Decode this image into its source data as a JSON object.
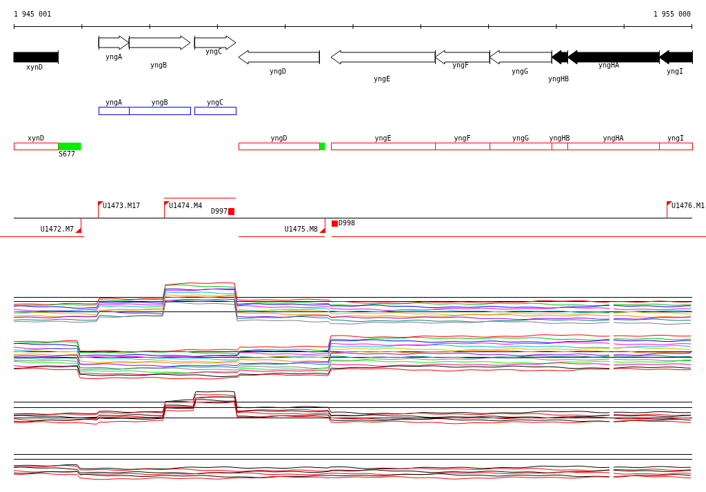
{
  "ruler": {
    "start_label": "1 945 001",
    "end_label": "1 955 000"
  },
  "genes": [
    {
      "name": "xynD",
      "reverse": true,
      "filled": true,
      "arrowhead": false
    },
    {
      "name": "yngA",
      "reverse": false,
      "filled": false,
      "arrowhead": true
    },
    {
      "name": "yngB",
      "reverse": false,
      "filled": false,
      "arrowhead": true
    },
    {
      "name": "yngC",
      "reverse": false,
      "filled": false,
      "arrowhead": true
    },
    {
      "name": "yngD",
      "reverse": true,
      "filled": false,
      "arrowhead": true
    },
    {
      "name": "yngE",
      "reverse": true,
      "filled": false,
      "arrowhead": true
    },
    {
      "name": "yngF",
      "reverse": true,
      "filled": false,
      "arrowhead": true
    },
    {
      "name": "yngG",
      "reverse": true,
      "filled": false,
      "arrowhead": true
    },
    {
      "name": "yngHB",
      "reverse": true,
      "filled": true,
      "arrowhead": true
    },
    {
      "name": "yngHA",
      "reverse": true,
      "filled": true,
      "arrowhead": true
    },
    {
      "name": "yngI",
      "reverse": true,
      "filled": true,
      "arrowhead": true
    }
  ],
  "blue_track": [
    {
      "name": "yngA"
    },
    {
      "name": "yngB"
    },
    {
      "name": "yngC"
    }
  ],
  "red_track": [
    {
      "name": "xynD",
      "green_tail": true,
      "tail_label": "S677"
    },
    {
      "name": "yngD",
      "green_tail": true
    },
    {
      "name": "yngE",
      "green_tail": false
    },
    {
      "name": "yngF",
      "green_tail": false
    },
    {
      "name": "yngG",
      "green_tail": false
    },
    {
      "name": "yngHB",
      "green_tail": false
    },
    {
      "name": "yngHA",
      "green_tail": false
    },
    {
      "name": "yngI",
      "green_tail": false
    }
  ],
  "markers": [
    {
      "label": "U1473.M17",
      "kind": "up"
    },
    {
      "label": "U1474.M4",
      "kind": "up"
    },
    {
      "label": "D997",
      "kind": "block_left"
    },
    {
      "label": "U1476.M1",
      "kind": "up"
    },
    {
      "label": "U1472.M7",
      "kind": "down"
    },
    {
      "label": "U1475.M8",
      "kind": "down"
    },
    {
      "label": "D998",
      "kind": "block_right"
    }
  ]
}
